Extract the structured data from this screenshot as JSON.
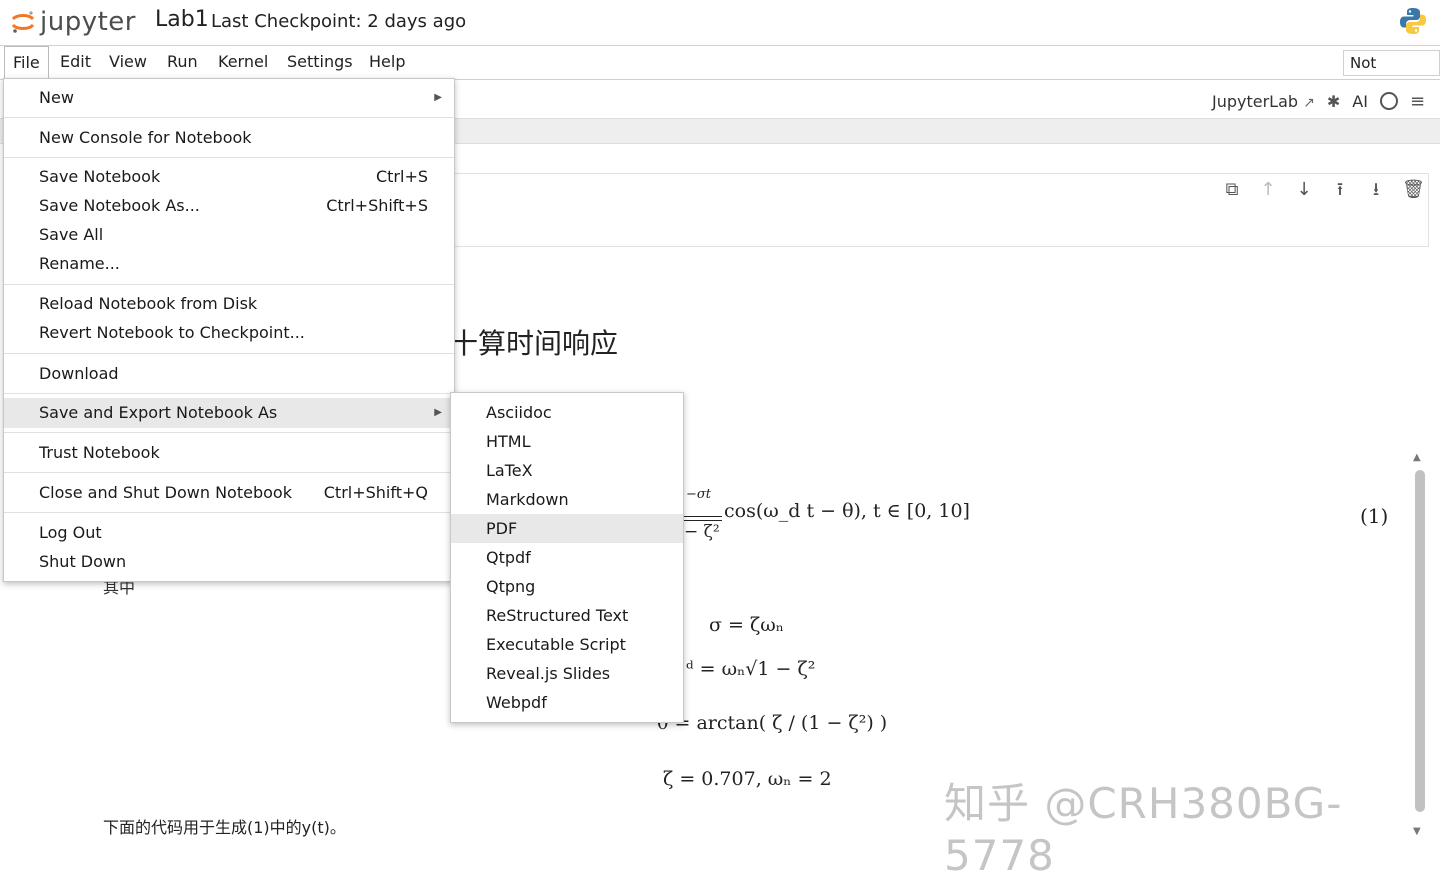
{
  "header": {
    "logo_text": "jupyter",
    "notebook_title": "Lab1",
    "checkpoint": "Last Checkpoint: 2 days ago"
  },
  "menubar": {
    "items": [
      "File",
      "Edit",
      "View",
      "Run",
      "Kernel",
      "Settings",
      "Help"
    ],
    "trust_status": "Not Trusted"
  },
  "toolbar": {
    "jupyterlab_label": "JupyterLab",
    "ai_label": "AI"
  },
  "file_menu": {
    "new": "New",
    "new_console": "New Console for Notebook",
    "save_notebook": "Save Notebook",
    "save_notebook_shortcut": "Ctrl+S",
    "save_as": "Save Notebook As...",
    "save_as_shortcut": "Ctrl+Shift+S",
    "save_all": "Save All",
    "rename": "Rename...",
    "reload": "Reload Notebook from Disk",
    "revert": "Revert Notebook to Checkpoint...",
    "download": "Download",
    "save_export": "Save and Export Notebook As",
    "trust": "Trust Notebook",
    "close_shutdown": "Close and Shut Down Notebook",
    "close_shutdown_shortcut": "Ctrl+Shift+Q",
    "log_out": "Log Out",
    "shut_down": "Shut Down"
  },
  "export_menu": {
    "items": [
      "Asciidoc",
      "HTML",
      "LaTeX",
      "Markdown",
      "PDF",
      "Qtpdf",
      "Qtpng",
      "ReStructured Text",
      "Executable Script",
      "Reveal.js Slides",
      "Webpdf"
    ],
    "highlighted": "PDF"
  },
  "notebook": {
    "heading_partial": "十算时间响应",
    "eq_main_top": "−σt",
    "eq_main": "cos(ω_d t − θ),    t ∈ [0, 10]",
    "eq_main_bottom": "− ζ²",
    "eq_number": "(1)",
    "eq_sigma": "σ = ζωₙ",
    "eq_omega": "ᵈ = ωₙ√1 − ζ²",
    "eq_theta": "θ = arctan( ζ / (1 − ζ²) )",
    "eq_zeta": "ζ = 0.707,  ωₙ = 2",
    "qizhong_partial": "其中",
    "bottom_text": "下面的代码用于生成(1)中的y(t)。"
  },
  "watermark": "知乎 @CRH380BG-5778"
}
